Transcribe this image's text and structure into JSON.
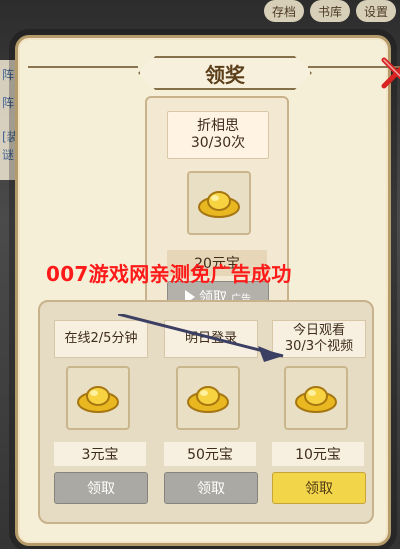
{
  "background": {
    "top_tabs": [
      "存档",
      "书库",
      "设置"
    ],
    "left_panel_text": [
      "阵",
      "阵",
      "[装",
      "谜"
    ]
  },
  "dialog": {
    "title": "领奖",
    "top_card": {
      "label_line1": "折相思",
      "label_line2": "30/30次",
      "amount": "20元宝",
      "claim_label": "领取",
      "ad_tag": "广告"
    },
    "promo": "007游戏网亲测免广告成功",
    "tasks": [
      {
        "label": "在线2/5分钟",
        "amount": "3元宝",
        "claim": "领取",
        "active": false
      },
      {
        "label": "明日登录",
        "amount": "50元宝",
        "claim": "领取",
        "active": false
      },
      {
        "label": "今日观看\n30/3个视频",
        "amount": "10元宝",
        "claim": "领取",
        "active": true
      }
    ]
  },
  "colors": {
    "promo_red": "#ff1a1a",
    "gold_btn": "#f3d54a",
    "gray_btn": "#aaa9a3"
  }
}
